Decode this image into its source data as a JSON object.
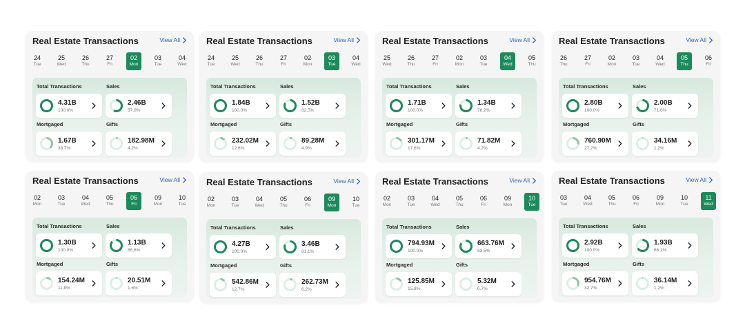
{
  "colors": {
    "accent": "#1c8a5c",
    "ring_light": "#8fc4a6",
    "ring_track": "#dceee4",
    "link": "#2f63b8"
  },
  "icons": {
    "view_all": "chevron-right-icon",
    "tile": "chevron-right-icon"
  },
  "cards": [
    {
      "title": "Real Estate Transactions",
      "view_all": "View All",
      "days": [
        {
          "num": "24",
          "dow": "Tue"
        },
        {
          "num": "25",
          "dow": "Wed"
        },
        {
          "num": "26",
          "dow": "Thu"
        },
        {
          "num": "27",
          "dow": "Fri"
        },
        {
          "num": "02",
          "dow": "Mon",
          "active": true
        },
        {
          "num": "03",
          "dow": "Tue"
        },
        {
          "num": "04",
          "dow": "Wed"
        }
      ],
      "labels": {
        "total": "Total Transactions",
        "sales": "Sales",
        "mortgaged": "Mortgaged",
        "gifts": "Gifts"
      },
      "tiles": {
        "total": {
          "value": "4.31B",
          "pct": "100.0%",
          "fraction": 1.0
        },
        "sales": {
          "value": "2.46B",
          "pct": "57.0%",
          "fraction": 0.57
        },
        "mortgaged": {
          "value": "1.67B",
          "pct": "38.7%",
          "fraction": 0.387
        },
        "gifts": {
          "value": "182.98M",
          "pct": "4.2%",
          "fraction": 0.042
        }
      }
    },
    {
      "title": "Real Estate Transactions",
      "view_all": "View All",
      "days": [
        {
          "num": "24",
          "dow": "Tue"
        },
        {
          "num": "25",
          "dow": "Wed"
        },
        {
          "num": "26",
          "dow": "Thu"
        },
        {
          "num": "27",
          "dow": "Fri"
        },
        {
          "num": "02",
          "dow": "Mon"
        },
        {
          "num": "03",
          "dow": "Tue",
          "active": true
        },
        {
          "num": "04",
          "dow": "Wed"
        }
      ],
      "labels": {
        "total": "Total Transactions",
        "sales": "Sales",
        "mortgaged": "Mortgaged",
        "gifts": "Gifts"
      },
      "tiles": {
        "total": {
          "value": "1.84B",
          "pct": "100.0%",
          "fraction": 1.0
        },
        "sales": {
          "value": "1.52B",
          "pct": "82.5%",
          "fraction": 0.825
        },
        "mortgaged": {
          "value": "232.02M",
          "pct": "12.6%",
          "fraction": 0.126
        },
        "gifts": {
          "value": "89.28M",
          "pct": "4.9%",
          "fraction": 0.049
        }
      }
    },
    {
      "title": "Real Estate Transactions",
      "view_all": "View All",
      "days": [
        {
          "num": "25",
          "dow": "Wed"
        },
        {
          "num": "26",
          "dow": "Thu"
        },
        {
          "num": "27",
          "dow": "Fri"
        },
        {
          "num": "02",
          "dow": "Mon"
        },
        {
          "num": "03",
          "dow": "Tue"
        },
        {
          "num": "04",
          "dow": "Wed",
          "active": true
        },
        {
          "num": "05",
          "dow": "Thu"
        }
      ],
      "labels": {
        "total": "Total Transactions",
        "sales": "Sales",
        "mortgaged": "Mortgaged",
        "gifts": "Gifts"
      },
      "tiles": {
        "total": {
          "value": "1.71B",
          "pct": "100.0%",
          "fraction": 1.0
        },
        "sales": {
          "value": "1.34B",
          "pct": "78.2%",
          "fraction": 0.782
        },
        "mortgaged": {
          "value": "301.17M",
          "pct": "17.6%",
          "fraction": 0.176
        },
        "gifts": {
          "value": "71.82M",
          "pct": "4.2%",
          "fraction": 0.042
        }
      }
    },
    {
      "title": "Real Estate Transactions",
      "view_all": "View All",
      "days": [
        {
          "num": "26",
          "dow": "Thu"
        },
        {
          "num": "27",
          "dow": "Fri"
        },
        {
          "num": "02",
          "dow": "Mon"
        },
        {
          "num": "03",
          "dow": "Tue"
        },
        {
          "num": "04",
          "dow": "Wed"
        },
        {
          "num": "05",
          "dow": "Thu",
          "active": true
        },
        {
          "num": "06",
          "dow": "Fri"
        }
      ],
      "labels": {
        "total": "Total Transactions",
        "sales": "Sales",
        "mortgaged": "Mortgaged",
        "gifts": "Gifts"
      },
      "tiles": {
        "total": {
          "value": "2.80B",
          "pct": "100.0%",
          "fraction": 1.0
        },
        "sales": {
          "value": "2.00B",
          "pct": "71.6%",
          "fraction": 0.716
        },
        "mortgaged": {
          "value": "760.90M",
          "pct": "27.2%",
          "fraction": 0.272
        },
        "gifts": {
          "value": "34.16M",
          "pct": "1.2%",
          "fraction": 0.012
        }
      }
    },
    {
      "title": "Real Estate Transactions",
      "view_all": "View All",
      "days": [
        {
          "num": "02",
          "dow": "Mon"
        },
        {
          "num": "03",
          "dow": "Tue"
        },
        {
          "num": "04",
          "dow": "Wed"
        },
        {
          "num": "05",
          "dow": "Thu"
        },
        {
          "num": "06",
          "dow": "Fri",
          "active": true
        },
        {
          "num": "09",
          "dow": "Mon"
        },
        {
          "num": "10",
          "dow": "Tue"
        }
      ],
      "labels": {
        "total": "Total Transactions",
        "sales": "Sales",
        "mortgaged": "Mortgaged",
        "gifts": "Gifts"
      },
      "tiles": {
        "total": {
          "value": "1.30B",
          "pct": "100.0%",
          "fraction": 1.0
        },
        "sales": {
          "value": "1.13B",
          "pct": "86.6%",
          "fraction": 0.866
        },
        "mortgaged": {
          "value": "154.24M",
          "pct": "11.8%",
          "fraction": 0.118
        },
        "gifts": {
          "value": "20.51M",
          "pct": "1.6%",
          "fraction": 0.016
        }
      }
    },
    {
      "title": "Real Estate Transactions",
      "view_all": "View All",
      "days": [
        {
          "num": "02",
          "dow": "Mon"
        },
        {
          "num": "03",
          "dow": "Tue"
        },
        {
          "num": "04",
          "dow": "Wed"
        },
        {
          "num": "05",
          "dow": "Thu"
        },
        {
          "num": "06",
          "dow": "Fri"
        },
        {
          "num": "09",
          "dow": "Mon",
          "active": true
        },
        {
          "num": "10",
          "dow": "Tue"
        }
      ],
      "labels": {
        "total": "Total Transactions",
        "sales": "Sales",
        "mortgaged": "Mortgaged",
        "gifts": "Gifts"
      },
      "tiles": {
        "total": {
          "value": "4.27B",
          "pct": "100.0%",
          "fraction": 1.0
        },
        "sales": {
          "value": "3.46B",
          "pct": "81.1%",
          "fraction": 0.811
        },
        "mortgaged": {
          "value": "542.86M",
          "pct": "12.7%",
          "fraction": 0.127
        },
        "gifts": {
          "value": "262.73M",
          "pct": "6.2%",
          "fraction": 0.062
        }
      }
    },
    {
      "title": "Real Estate Transactions",
      "view_all": "View All",
      "days": [
        {
          "num": "02",
          "dow": "Mon"
        },
        {
          "num": "03",
          "dow": "Tue"
        },
        {
          "num": "04",
          "dow": "Wed"
        },
        {
          "num": "05",
          "dow": "Thu"
        },
        {
          "num": "06",
          "dow": "Fri"
        },
        {
          "num": "09",
          "dow": "Mon"
        },
        {
          "num": "10",
          "dow": "Tue",
          "active": true
        }
      ],
      "labels": {
        "total": "Total Transactions",
        "sales": "Sales",
        "mortgaged": "Mortgaged",
        "gifts": "Gifts"
      },
      "tiles": {
        "total": {
          "value": "794.93M",
          "pct": "100.0%",
          "fraction": 1.0
        },
        "sales": {
          "value": "663.76M",
          "pct": "83.5%",
          "fraction": 0.835
        },
        "mortgaged": {
          "value": "125.85M",
          "pct": "15.8%",
          "fraction": 0.158
        },
        "gifts": {
          "value": "5.32M",
          "pct": "0.7%",
          "fraction": 0.007
        }
      }
    },
    {
      "title": "Real Estate Transactions",
      "view_all": "View All",
      "days": [
        {
          "num": "03",
          "dow": "Tue"
        },
        {
          "num": "04",
          "dow": "Wed"
        },
        {
          "num": "05",
          "dow": "Thu"
        },
        {
          "num": "06",
          "dow": "Fri"
        },
        {
          "num": "09",
          "dow": "Mon"
        },
        {
          "num": "10",
          "dow": "Tue"
        },
        {
          "num": "11",
          "dow": "Wed",
          "active": true
        }
      ],
      "labels": {
        "total": "Total Transactions",
        "sales": "Sales",
        "mortgaged": "Mortgaged",
        "gifts": "Gifts"
      },
      "tiles": {
        "total": {
          "value": "2.92B",
          "pct": "100.0%",
          "fraction": 1.0
        },
        "sales": {
          "value": "1.93B",
          "pct": "66.1%",
          "fraction": 0.661
        },
        "mortgaged": {
          "value": "954.76M",
          "pct": "32.7%",
          "fraction": 0.327
        },
        "gifts": {
          "value": "36.14M",
          "pct": "1.2%",
          "fraction": 0.012
        }
      }
    }
  ]
}
